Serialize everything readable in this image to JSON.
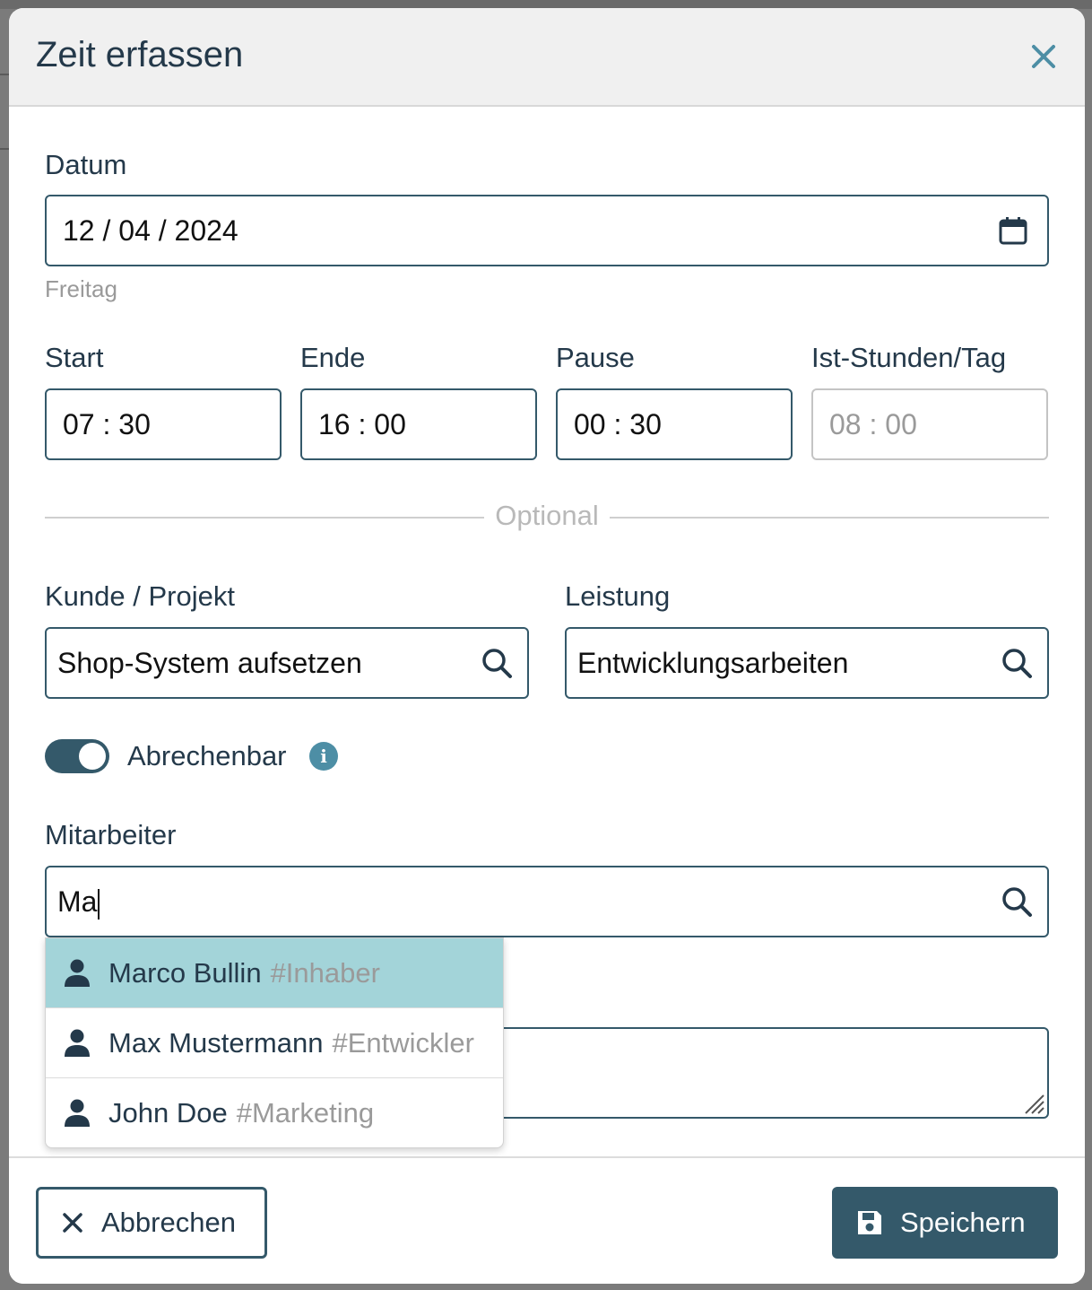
{
  "modal": {
    "title": "Zeit erfassen"
  },
  "form": {
    "date": {
      "label": "Datum",
      "value": "12 / 04 / 2024",
      "weekday": "Freitag"
    },
    "start": {
      "label": "Start",
      "value": "07 : 30"
    },
    "end": {
      "label": "Ende",
      "value": "16 : 00"
    },
    "pause": {
      "label": "Pause",
      "value": "00 : 30"
    },
    "hours": {
      "label": "Ist-Stunden/Tag",
      "value": "08 : 00"
    },
    "optional_label": "Optional",
    "project": {
      "label": "Kunde / Projekt",
      "value": "Shop-System aufsetzen"
    },
    "service": {
      "label": "Leistung",
      "value": "Entwicklungsarbeiten"
    },
    "billable": {
      "label": "Abrechenbar",
      "on": true
    },
    "employee": {
      "label": "Mitarbeiter",
      "value": "Ma"
    }
  },
  "dropdown": {
    "items": [
      {
        "name": "Marco Bullin",
        "role": "#Inhaber",
        "active": true
      },
      {
        "name": "Max Mustermann",
        "role": "#Entwickler",
        "active": false
      },
      {
        "name": "John Doe",
        "role": "#Marketing",
        "active": false
      }
    ]
  },
  "footer": {
    "cancel_label": "Abbrechen",
    "save_label": "Speichern"
  },
  "colors": {
    "primary": "#34596a",
    "highlight": "#a3d4d9",
    "info": "#4d8ea5"
  },
  "icons": [
    "close-icon",
    "calendar-icon",
    "search-icon",
    "info-icon",
    "person-icon",
    "save-icon"
  ]
}
